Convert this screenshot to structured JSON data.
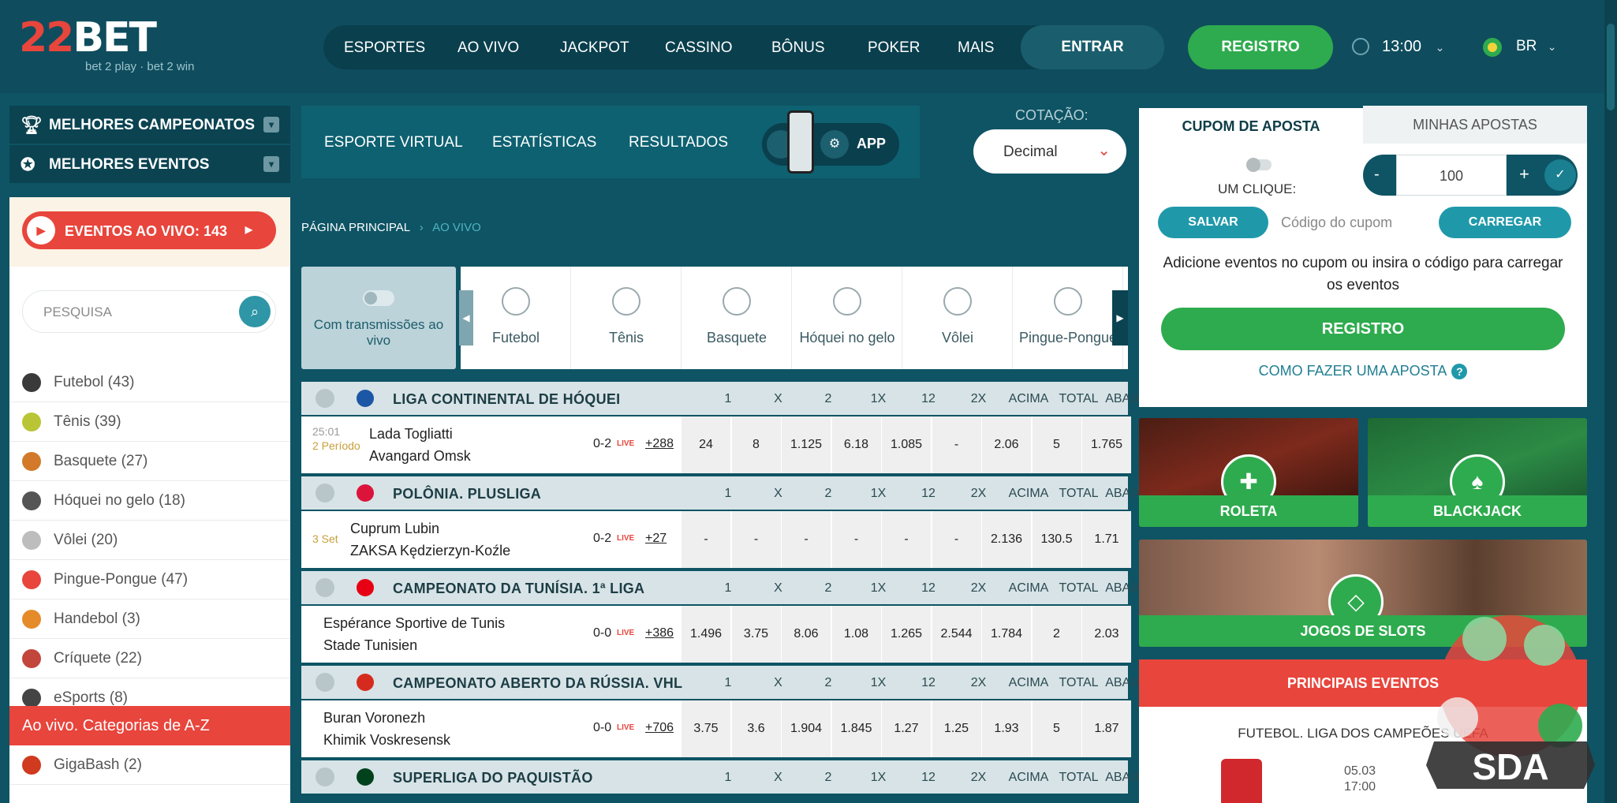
{
  "header": {
    "logo_main": "22BET",
    "logo_sub": "bet 2 play · bet 2 win",
    "nav": [
      "ESPORTES",
      "AO VIVO",
      "JACKPOT",
      "CASSINO",
      "BÔNUS",
      "POKER",
      "MAIS"
    ],
    "login": "ENTRAR",
    "register": "REGISTRO",
    "time": "13:00",
    "language": "BR"
  },
  "left_menu": {
    "top_leagues": "MELHORES CAMPEONATOS",
    "top_events": "MELHORES EVENTOS",
    "live_events": "EVENTOS AO VIVO: 143",
    "search_placeholder": "PESQUISA",
    "sports": [
      {
        "label": "Futebol (43)",
        "icon": "soccer-ball-icon",
        "color": "#3a3a3a"
      },
      {
        "label": "Tênis (39)",
        "icon": "tennis-ball-icon",
        "color": "#b9c534"
      },
      {
        "label": "Basquete (27)",
        "icon": "basketball-icon",
        "color": "#d27a2a"
      },
      {
        "label": "Hóquei no gelo (18)",
        "icon": "hockey-skate-icon",
        "color": "#555555"
      },
      {
        "label": "Vôlei (20)",
        "icon": "volleyball-icon",
        "color": "#bdbdbd"
      },
      {
        "label": "Pingue-Pongue (47)",
        "icon": "ping-pong-icon",
        "color": "#e8453c"
      },
      {
        "label": "Handebol (3)",
        "icon": "handball-icon",
        "color": "#e58b2a"
      },
      {
        "label": "Críquete (22)",
        "icon": "cricket-icon",
        "color": "#c2463b"
      },
      {
        "label": "eSports (8)",
        "icon": "gamepad-icon",
        "color": "#444444"
      }
    ],
    "categories_az": "Ao vivo. Categorias de A-Z",
    "extra_item": {
      "label": "GigaBash (2)",
      "icon": "gigabash-icon",
      "color": "#d03a1f"
    }
  },
  "subnav": {
    "items": [
      "ESPORTE VIRTUAL",
      "ESTATÍSTICAS",
      "RESULTADOS"
    ],
    "app_label": "APP",
    "odds_label": "COTAÇÃO:",
    "odds_value": "Decimal"
  },
  "breadcrumb": {
    "home": "PÁGINA PRINCIPAL",
    "separator": "›",
    "current": "AO VIVO"
  },
  "filter": {
    "streams_label": "Com transmissões ao vivo",
    "sport_tabs": [
      "Futebol",
      "Tênis",
      "Basquete",
      "Hóquei no gelo",
      "Vôlei",
      "Pingue-Pongue"
    ]
  },
  "odds_headers": [
    "1",
    "X",
    "2",
    "1X",
    "12",
    "2X",
    "ACIMA",
    "TOTAL",
    "ABAIXO"
  ],
  "leagues": [
    {
      "name": "LIGA CONTINENTAL DE HÓQUEI",
      "flag_color": "#1c57a5",
      "event": {
        "time": "25:01",
        "period": "2 Período",
        "team1": "Lada Togliatti",
        "team2": "Avangard Omsk",
        "score": "0-2",
        "live": "LIVE",
        "more": "+288",
        "odds": [
          "24",
          "8",
          "1.125",
          "6.18",
          "1.085",
          "-",
          "2.06",
          "5",
          "1.765"
        ]
      }
    },
    {
      "name": "POLÔNIA. PLUSLIGA",
      "flag_color": "#dc143c",
      "event": {
        "time": "",
        "period": "3 Set",
        "team1": "Cuprum Lubin",
        "team2": "ZAKSA Kędzierzyn-Koźle",
        "score": "0-2",
        "live": "LIVE",
        "more": "+27",
        "odds": [
          "-",
          "-",
          "-",
          "-",
          "-",
          "-",
          "2.136",
          "130.5",
          "1.71"
        ]
      }
    },
    {
      "name": "CAMPEONATO DA TUNÍSIA. 1ª LIGA",
      "flag_color": "#e70013",
      "event": {
        "time": "",
        "period": "",
        "team1": "Espérance Sportive de Tunis",
        "team2": "Stade Tunisien",
        "score": "0-0",
        "live": "LIVE",
        "more": "+386",
        "odds": [
          "1.496",
          "3.75",
          "8.06",
          "1.08",
          "1.265",
          "2.544",
          "1.784",
          "2",
          "2.03"
        ]
      }
    },
    {
      "name": "CAMPEONATO ABERTO DA RÚSSIA. VHL",
      "flag_color": "#d52b1e",
      "event": {
        "time": "",
        "period": "",
        "team1": "Buran Voronezh",
        "team2": "Khimik Voskresensk",
        "score": "0-0",
        "live": "LIVE",
        "more": "+706",
        "odds": [
          "3.75",
          "3.6",
          "1.904",
          "1.845",
          "1.27",
          "1.25",
          "1.93",
          "5",
          "1.87"
        ]
      }
    },
    {
      "name": "SUPERLIGA DO PAQUISTÃO",
      "flag_color": "#01411c"
    }
  ],
  "coupon": {
    "tab_active": "CUPOM DE APOSTA",
    "tab_other": "MINHAS APOSTAS",
    "one_click": "UM CLIQUE:",
    "minus": "-",
    "stake": "100",
    "plus": "+",
    "confirm": "✓",
    "save": "SALVAR",
    "code_placeholder": "Código do cupom",
    "load": "CARREGAR",
    "info": "Adicione eventos no cupom ou insira o código para carregar os eventos",
    "register": "REGISTRO",
    "how_to": "COMO FAZER UMA APOSTA",
    "help_icon": "?"
  },
  "casino_tiles": {
    "roulette": "ROLETA",
    "blackjack": "BLACKJACK",
    "slots": "JOGOS DE SLOTS"
  },
  "top_events": {
    "title": "PRINCIPAIS EVENTOS",
    "league": "FUTEBOL. LIGA DOS CAMPEÕES UEFA",
    "date": "05.03",
    "time": "17:00"
  },
  "watermark": "SDA"
}
